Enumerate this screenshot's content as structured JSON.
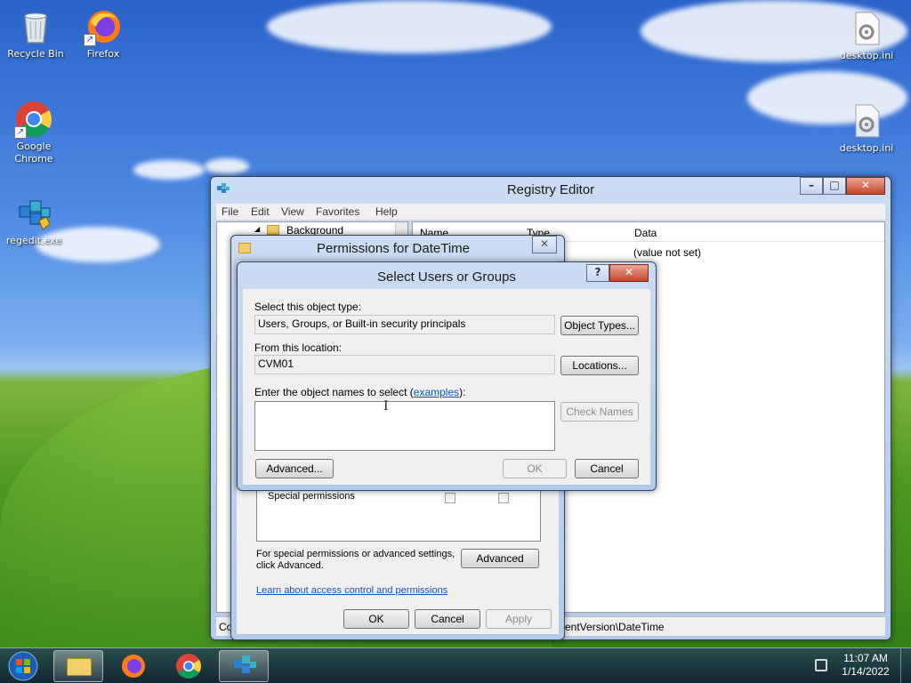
{
  "desktop": {
    "icons": [
      {
        "label": "Recycle Bin"
      },
      {
        "label": "Firefox"
      },
      {
        "label": "Google Chrome"
      },
      {
        "label": "regedit.exe"
      },
      {
        "label": "desktop.ini"
      },
      {
        "label": "desktop.ini"
      }
    ]
  },
  "registry_editor": {
    "title": "Registry Editor",
    "menu": [
      "File",
      "Edit",
      "View",
      "Favorites",
      "Help"
    ],
    "tree_item": "Background",
    "columns": {
      "name": "Name",
      "type": "Type",
      "data": "Data"
    },
    "row_data": "(value not set)",
    "status_path": "Co",
    "status_path_tail": "entVersion\\DateTime"
  },
  "permissions_dialog": {
    "title": "Permissions for DateTime",
    "special_permissions_label": "Special permissions",
    "special_settings_text_1": "For special permissions or advanced settings,",
    "special_settings_text_2": "click Advanced.",
    "advanced_button": "Advanced",
    "learn_link": "Learn about access control and permissions",
    "ok_button": "OK",
    "cancel_button": "Cancel",
    "apply_button": "Apply"
  },
  "select_dialog": {
    "title": "Select Users or Groups",
    "help_glyph": "?",
    "object_type_label": "Select this object type:",
    "object_type_value": "Users, Groups, or Built-in security principals",
    "object_types_button": "Object Types...",
    "location_label": "From this location:",
    "location_value": "CVM01",
    "locations_button": "Locations...",
    "enter_names_label": "Enter the object names to select (",
    "examples_link": "examples",
    "enter_names_suffix": "):",
    "enter_names_value": "",
    "check_names_button": "Check Names",
    "advanced_button": "Advanced...",
    "ok_button": "OK",
    "cancel_button": "Cancel"
  },
  "taskbar": {
    "time": "11:07 AM",
    "date": "1/14/2022"
  }
}
